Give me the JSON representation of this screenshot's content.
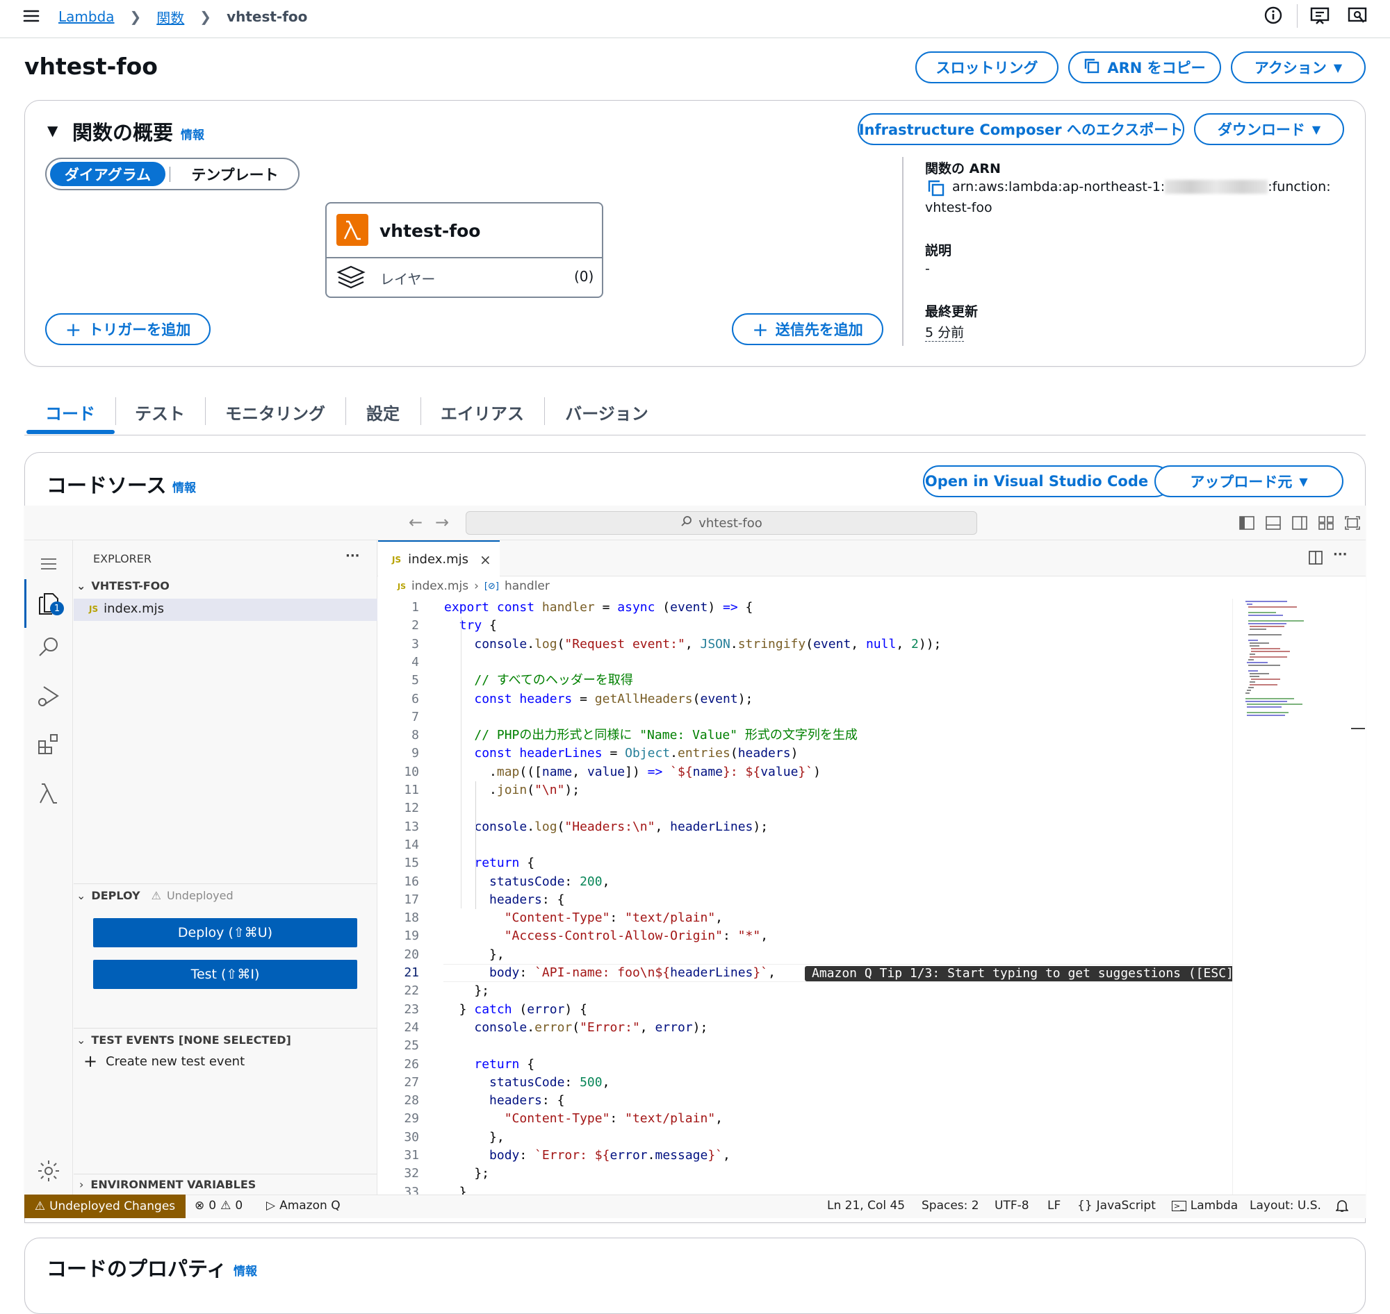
{
  "breadcrumb": {
    "items": [
      "Lambda",
      "関数",
      "vhtest-foo"
    ]
  },
  "page": {
    "title": "vhtest-foo"
  },
  "header_actions": {
    "throttle": "スロットリング",
    "copy_arn": "ARN をコピー",
    "actions": "アクション"
  },
  "overview": {
    "title": "関数の概要",
    "info": "情報",
    "export": "Infrastructure Composer へのエクスポート",
    "download": "ダウンロード",
    "toggle": {
      "diagram": "ダイアグラム",
      "template": "テンプレート"
    },
    "function_box": {
      "name": "vhtest-foo",
      "layers_label": "レイヤー",
      "layers_count": "(0)"
    },
    "add_trigger": "トリガーを追加",
    "add_destination": "送信先を追加",
    "arn_label": "関数の ARN",
    "arn_prefix": "arn:aws:lambda:ap-northeast-1:",
    "arn_suffix": ":function:",
    "arn_name": "vhtest-foo",
    "description_label": "説明",
    "description_value": "-",
    "last_modified_label": "最終更新",
    "last_modified_value": "5 分前"
  },
  "tabs": [
    "コード",
    "テスト",
    "モニタリング",
    "設定",
    "エイリアス",
    "バージョン"
  ],
  "code_source": {
    "title": "コードソース",
    "info": "情報",
    "open_vscode": "Open in Visual Studio Code",
    "upload_from": "アップロード元"
  },
  "editor": {
    "search_placeholder": "vhtest-foo",
    "explorer_title": "EXPLORER",
    "explorer_more": "···",
    "folder": "VHTEST-FOO",
    "file": "index.mjs",
    "file_badge": "JS",
    "tab_file": "index.mjs",
    "crumb_file": "index.mjs",
    "crumb_symbol": "handler",
    "deploy_section": "DEPLOY",
    "deploy_status": "Undeployed",
    "deploy_button": "Deploy (⇧⌘U)",
    "test_button": "Test (⇧⌘I)",
    "test_events_section": "TEST EVENTS [NONE SELECTED]",
    "create_test_event": "Create new test event",
    "env_vars_section": "ENVIRONMENT VARIABLES",
    "explorer_badge": "1",
    "tooltip": "Amazon Q Tip 1/3: Start typing to get suggestions ([ESC]"
  },
  "status_bar": {
    "undeployed": "Undeployed Changes",
    "errors": "0",
    "warnings": "0",
    "amazon_q": "Amazon Q",
    "position": "Ln 21, Col 45",
    "spaces": "Spaces: 2",
    "encoding": "UTF-8",
    "eol": "LF",
    "language": "JavaScript",
    "lambda": "Lambda",
    "layout": "Layout: U.S."
  },
  "code_properties": {
    "title": "コードのプロパティ",
    "info": "情報"
  },
  "colors": {
    "accent": "#0972d3",
    "vscode_blue": "#005fb8",
    "warning_bar": "#8a5a00",
    "lambda_orange": "#ed7100"
  },
  "code": {
    "lines": [
      [
        [
          "kw",
          "export "
        ],
        [
          "kw",
          "const "
        ],
        [
          "fn",
          "handler"
        ],
        [
          "pu",
          " = "
        ],
        [
          "kw",
          "async "
        ],
        [
          "pu",
          "("
        ],
        [
          "var",
          "event"
        ],
        [
          "pu",
          ") "
        ],
        [
          "kw",
          "=> "
        ],
        [
          "pu",
          "{"
        ]
      ],
      [
        [
          "pu",
          "  "
        ],
        [
          "kw",
          "try "
        ],
        [
          "pu",
          "{"
        ]
      ],
      [
        [
          "pu",
          "    "
        ],
        [
          "var",
          "console"
        ],
        [
          "pu",
          "."
        ],
        [
          "fn",
          "log"
        ],
        [
          "pu",
          "("
        ],
        [
          "str",
          "\"Request event:\""
        ],
        [
          "pu",
          ", "
        ],
        [
          "typ",
          "JSON"
        ],
        [
          "pu",
          "."
        ],
        [
          "fn",
          "stringify"
        ],
        [
          "pu",
          "("
        ],
        [
          "var",
          "event"
        ],
        [
          "pu",
          ", "
        ],
        [
          "kw",
          "null"
        ],
        [
          "pu",
          ", "
        ],
        [
          "num",
          "2"
        ],
        [
          "pu",
          "));"
        ]
      ],
      [
        [
          "pu",
          ""
        ]
      ],
      [
        [
          "pu",
          "    "
        ],
        [
          "cmt",
          "// すべてのヘッダーを取得"
        ]
      ],
      [
        [
          "pu",
          "    "
        ],
        [
          "kw",
          "const "
        ],
        [
          "kw",
          "headers"
        ],
        [
          "pu",
          " = "
        ],
        [
          "fn",
          "getAllHeaders"
        ],
        [
          "pu",
          "("
        ],
        [
          "var",
          "event"
        ],
        [
          "pu",
          ");"
        ]
      ],
      [
        [
          "pu",
          ""
        ]
      ],
      [
        [
          "pu",
          "    "
        ],
        [
          "cmt",
          "// PHPの出力形式と同様に \"Name: Value\" 形式の文字列を生成"
        ]
      ],
      [
        [
          "pu",
          "    "
        ],
        [
          "kw",
          "const "
        ],
        [
          "kw",
          "headerLines"
        ],
        [
          "pu",
          " = "
        ],
        [
          "typ",
          "Object"
        ],
        [
          "pu",
          "."
        ],
        [
          "fn",
          "entries"
        ],
        [
          "pu",
          "("
        ],
        [
          "var",
          "headers"
        ],
        [
          "pu",
          ")"
        ]
      ],
      [
        [
          "pu",
          "      ."
        ],
        [
          "fn",
          "map"
        ],
        [
          "pu",
          "((["
        ],
        [
          "var",
          "name"
        ],
        [
          "pu",
          ", "
        ],
        [
          "var",
          "value"
        ],
        [
          "pu",
          "]) "
        ],
        [
          "kw",
          "=> "
        ],
        [
          "tpl",
          "`${"
        ],
        [
          "var",
          "name"
        ],
        [
          "tpl",
          "}: ${"
        ],
        [
          "var",
          "value"
        ],
        [
          "tpl",
          "}`"
        ],
        [
          "pu",
          ")"
        ]
      ],
      [
        [
          "pu",
          "      ."
        ],
        [
          "fn",
          "join"
        ],
        [
          "pu",
          "("
        ],
        [
          "str",
          "\"\\n\""
        ],
        [
          "pu",
          ");"
        ]
      ],
      [
        [
          "pu",
          ""
        ]
      ],
      [
        [
          "pu",
          "    "
        ],
        [
          "var",
          "console"
        ],
        [
          "pu",
          "."
        ],
        [
          "fn",
          "log"
        ],
        [
          "pu",
          "("
        ],
        [
          "str",
          "\"Headers:\\n\""
        ],
        [
          "pu",
          ", "
        ],
        [
          "var",
          "headerLines"
        ],
        [
          "pu",
          ");"
        ]
      ],
      [
        [
          "pu",
          ""
        ]
      ],
      [
        [
          "pu",
          "    "
        ],
        [
          "kw",
          "return "
        ],
        [
          "pu",
          "{"
        ]
      ],
      [
        [
          "pu",
          "      "
        ],
        [
          "var",
          "statusCode"
        ],
        [
          "pu",
          ": "
        ],
        [
          "num",
          "200"
        ],
        [
          "pu",
          ","
        ]
      ],
      [
        [
          "pu",
          "      "
        ],
        [
          "var",
          "headers"
        ],
        [
          "pu",
          ": {"
        ]
      ],
      [
        [
          "pu",
          "        "
        ],
        [
          "str",
          "\"Content-Type\""
        ],
        [
          "pu",
          ": "
        ],
        [
          "str",
          "\"text/plain\""
        ],
        [
          "pu",
          ","
        ]
      ],
      [
        [
          "pu",
          "        "
        ],
        [
          "str",
          "\"Access-Control-Allow-Origin\""
        ],
        [
          "pu",
          ": "
        ],
        [
          "str",
          "\"*\""
        ],
        [
          "pu",
          ","
        ]
      ],
      [
        [
          "pu",
          "      },"
        ]
      ],
      [
        [
          "pu",
          "      "
        ],
        [
          "var",
          "body"
        ],
        [
          "pu",
          ": "
        ],
        [
          "tpl",
          "`API-name: foo\\n${"
        ],
        [
          "var",
          "headerLines"
        ],
        [
          "tpl",
          "}`"
        ],
        [
          "pu",
          ","
        ]
      ],
      [
        [
          "pu",
          "    };"
        ]
      ],
      [
        [
          "pu",
          "  } "
        ],
        [
          "kw",
          "catch "
        ],
        [
          "pu",
          "("
        ],
        [
          "var",
          "error"
        ],
        [
          "pu",
          ") {"
        ]
      ],
      [
        [
          "pu",
          "    "
        ],
        [
          "var",
          "console"
        ],
        [
          "pu",
          "."
        ],
        [
          "fn",
          "error"
        ],
        [
          "pu",
          "("
        ],
        [
          "str",
          "\"Error:\""
        ],
        [
          "pu",
          ", "
        ],
        [
          "var",
          "error"
        ],
        [
          "pu",
          ");"
        ]
      ],
      [
        [
          "pu",
          ""
        ]
      ],
      [
        [
          "pu",
          "    "
        ],
        [
          "kw",
          "return "
        ],
        [
          "pu",
          "{"
        ]
      ],
      [
        [
          "pu",
          "      "
        ],
        [
          "var",
          "statusCode"
        ],
        [
          "pu",
          ": "
        ],
        [
          "num",
          "500"
        ],
        [
          "pu",
          ","
        ]
      ],
      [
        [
          "pu",
          "      "
        ],
        [
          "var",
          "headers"
        ],
        [
          "pu",
          ": {"
        ]
      ],
      [
        [
          "pu",
          "        "
        ],
        [
          "str",
          "\"Content-Type\""
        ],
        [
          "pu",
          ": "
        ],
        [
          "str",
          "\"text/plain\""
        ],
        [
          "pu",
          ","
        ]
      ],
      [
        [
          "pu",
          "      },"
        ]
      ],
      [
        [
          "pu",
          "      "
        ],
        [
          "var",
          "body"
        ],
        [
          "pu",
          ": "
        ],
        [
          "tpl",
          "`Error: ${"
        ],
        [
          "var",
          "error"
        ],
        [
          "pu",
          "."
        ],
        [
          "var",
          "message"
        ],
        [
          "tpl",
          "}`"
        ],
        [
          "pu",
          ","
        ]
      ],
      [
        [
          "pu",
          "    };"
        ]
      ],
      [
        [
          "pu",
          "  }"
        ]
      ]
    ]
  }
}
